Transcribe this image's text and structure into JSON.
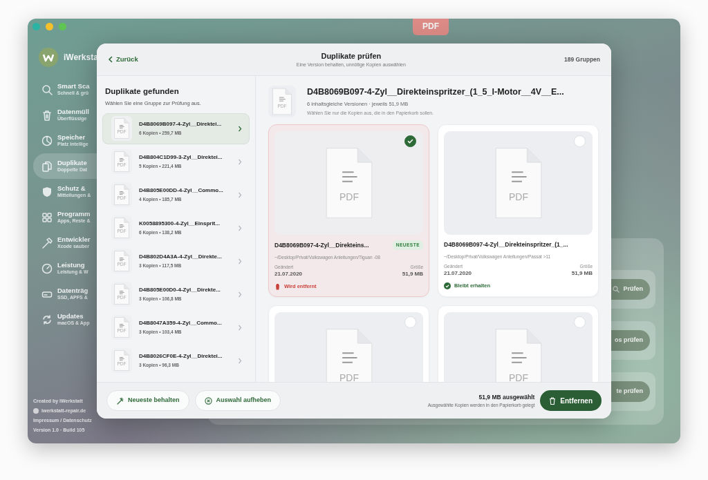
{
  "floating_badge": "PDF",
  "sidebar": {
    "brand": "iWerksta",
    "items": [
      {
        "title": "Smart Sca",
        "subtitle": "Schnell & grü",
        "selected": false
      },
      {
        "title": "Datenmüll",
        "subtitle": "Überflüssige",
        "selected": false
      },
      {
        "title": "Speicher",
        "subtitle": "Platz intellige",
        "selected": false
      },
      {
        "title": "Duplikate",
        "subtitle": "Doppelte Dat",
        "selected": true
      },
      {
        "title": "Schutz &",
        "subtitle": "Mitteilungen &",
        "selected": false
      },
      {
        "title": "Programm",
        "subtitle": "Apps, Reste &",
        "selected": false
      },
      {
        "title": "Entwickler",
        "subtitle": "Xcode sauber",
        "selected": false
      },
      {
        "title": "Leistung",
        "subtitle": "Leistung & W",
        "selected": false
      },
      {
        "title": "Datenträg",
        "subtitle": "SSD, APFS &",
        "selected": false
      },
      {
        "title": "Updates",
        "subtitle": "macOS & App",
        "selected": false
      }
    ],
    "footer": {
      "credit": "Created by iWerkstatt",
      "website": "iwerkstatt-repair.de",
      "legal": "Impressum / Datenschutz",
      "version": "Version 1.0 · Build 105"
    }
  },
  "background_actions": [
    {
      "label": "Prüfen"
    },
    {
      "label": "os prüfen"
    },
    {
      "label": "te prüfen"
    }
  ],
  "dialog": {
    "back": "Zurück",
    "title": "Duplikate prüfen",
    "subtitle": "Eine Version behalten, unnötige Kopien auswählen",
    "count": "189 Gruppen",
    "list_title": "Duplikate gefunden",
    "list_subtitle": "Wählen Sie eine Gruppe zur Prüfung aus.",
    "groups": [
      {
        "name": "D4B8069B097-4-Zyl__Direktei...",
        "meta": "6 Kopien • 259,7 MB",
        "type_label": "PDF",
        "selected": true
      },
      {
        "name": "D4B804C1D99-3-Zyl__Direktei...",
        "meta": "5 Kopien • 221,4 MB",
        "type_label": "PDF",
        "selected": false
      },
      {
        "name": "D4B805E00DD-4-Zyl__Commo...",
        "meta": "4 Kopien • 185,7 MB",
        "type_label": "PDF",
        "selected": false
      },
      {
        "name": "K0058895300-4-Zyl__Einsprit...",
        "meta": "6 Kopien • 138,2 MB",
        "type_label": "PDF",
        "selected": false
      },
      {
        "name": "D4B802D4A3A-4-Zyl__Direkte...",
        "meta": "3 Kopien • 117,5 MB",
        "type_label": "PDF",
        "selected": false
      },
      {
        "name": "D4B805E00D0-4-Zyl__Direkte...",
        "meta": "3 Kopien • 106,8 MB",
        "type_label": "PDF",
        "selected": false
      },
      {
        "name": "D4B8047A359-4-Zyl__Commo...",
        "meta": "3 Kopien • 103,4 MB",
        "type_label": "PDF",
        "selected": false
      },
      {
        "name": "D4B8026CF0E-4-Zyl__Direktei...",
        "meta": "3 Kopien • 96,3 MB",
        "type_label": "PDF",
        "selected": false
      }
    ],
    "file": {
      "title": "D4B8069B097-4-Zyl__Direkteinspritzer_(1_5_l-Motor__4V__E...",
      "meta": "6 inhaltsgleiche Versionen · jeweils 51,9 MB",
      "hint": "Wählen Sie nur die Kopien aus, die in den Papierkorb sollen.",
      "type_label": "PDF"
    },
    "copies": [
      {
        "selected": true,
        "type_label": "PDF",
        "name": "D4B8069B097-4-Zyl__Direkteins...",
        "badge": "NEUESTE",
        "path": "~/Desktop/Privat/Volkswagen Anleitungen/Tiguan -08",
        "changed_label": "Geändert",
        "changed": "21.07.2020",
        "size_label": "Größe",
        "size": "51,9 MB",
        "status": "Wird entfernt"
      },
      {
        "selected": false,
        "type_label": "PDF",
        "name": "D4B8069B097-4-Zyl__Direkteinspritzer_(1_...",
        "path": "~/Desktop/Privat/Volkswagen Anleitungen/Passat >11",
        "changed_label": "Geändert",
        "changed": "21.07.2020",
        "size_label": "Größe",
        "size": "51,9 MB",
        "status": "Bleibt erhalten"
      },
      {
        "selected": false,
        "type_label": "PDF"
      },
      {
        "selected": false,
        "type_label": "PDF"
      }
    ],
    "footer": {
      "keep_newest": "Neueste behalten",
      "clear_selection": "Auswahl aufheben",
      "selected_size": "51,9 MB ausgewählt",
      "selected_hint": "Ausgewählte Kopien werden in den Papierkorb gelegt",
      "remove": "Entfernen"
    }
  }
}
